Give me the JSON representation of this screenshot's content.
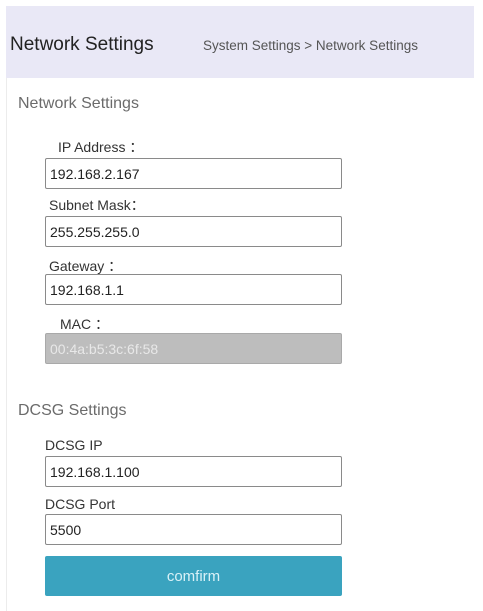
{
  "header": {
    "title": "Network Settings",
    "breadcrumb": "System Settings > Network Settings"
  },
  "network": {
    "section_title": "Network Settings",
    "ip_label": "IP Address ：",
    "ip_value": "192.168.2.167",
    "subnet_label": "Subnet Mask：",
    "subnet_value": "255.255.255.0",
    "gateway_label": "Gateway  ：",
    "gateway_value": "192.168.1.1",
    "mac_label": "MAC  ：",
    "mac_value": "00:4a:b5:3c:6f:58"
  },
  "dcsg": {
    "section_title": "DCSG Settings",
    "ip_label": "DCSG IP",
    "ip_value": "192.168.1.100",
    "port_label": "DCSG Port",
    "port_value": "5500"
  },
  "actions": {
    "confirm_label": "comfirm"
  },
  "colors": {
    "header_background": "#e9e8f6",
    "button_background": "#3aa3bf",
    "disabled_field": "#bdbdbd"
  }
}
